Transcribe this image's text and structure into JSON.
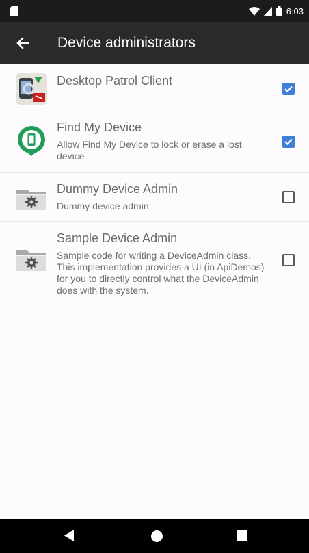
{
  "status_bar": {
    "time": "6:03",
    "icons": [
      "sd-card-icon",
      "wifi-icon",
      "signal-icon",
      "battery-icon"
    ]
  },
  "toolbar": {
    "title": "Device administrators",
    "back_icon": "arrow-left-icon"
  },
  "admins": [
    {
      "name": "Desktop Patrol Client",
      "description": "",
      "icon": "desktop-patrol-icon",
      "checked": true
    },
    {
      "name": "Find My Device",
      "description": "Allow Find My Device to lock or erase a lost device",
      "icon": "find-my-device-icon",
      "checked": true
    },
    {
      "name": "Dummy Device Admin",
      "description": "Dummy device admin",
      "icon": "folder-gear-icon",
      "checked": false
    },
    {
      "name": "Sample Device Admin",
      "description": "Sample code for writing a DeviceAdmin class. This implementation provides a UI (in ApiDemos) for you to directly control what the DeviceAdmin does with the system.",
      "icon": "folder-gear-icon",
      "checked": false
    }
  ],
  "colors": {
    "toolbar": "#2a2a2a",
    "status_bar": "#1c1c1c",
    "checkbox_checked": "#3f7fd6",
    "find_my_device_green": "#1f9e59"
  },
  "nav_bar": {
    "icons": [
      "nav-back-icon",
      "nav-home-icon",
      "nav-recents-icon"
    ]
  }
}
